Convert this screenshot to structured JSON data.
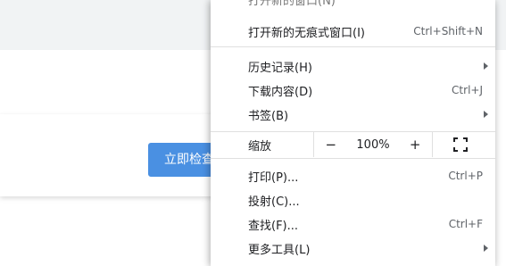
{
  "background": {
    "check_button_label": "立即检查"
  },
  "menu": {
    "partial_top_label": "打开新的窗口(N)",
    "items_group1": [
      {
        "label": "打开新的无痕式窗口(I)",
        "shortcut": "Ctrl+Shift+N"
      }
    ],
    "items_group2": [
      {
        "label": "历史记录(H)",
        "shortcut": "",
        "submenu": true
      },
      {
        "label": "下载内容(D)",
        "shortcut": "Ctrl+J",
        "submenu": false
      },
      {
        "label": "书签(B)",
        "shortcut": "",
        "submenu": true
      }
    ],
    "zoom": {
      "label": "缩放",
      "minus": "−",
      "value": "100%",
      "plus": "+"
    },
    "items_group3": [
      {
        "label": "打印(P)...",
        "shortcut": "Ctrl+P",
        "submenu": false
      },
      {
        "label": "投射(C)...",
        "shortcut": "",
        "submenu": false
      },
      {
        "label": "查找(F)...",
        "shortcut": "Ctrl+F",
        "submenu": false
      },
      {
        "label": "更多工具(L)",
        "shortcut": "",
        "submenu": true
      }
    ]
  },
  "colors": {
    "accent": "#4a90e2",
    "menu_bg": "#ffffff",
    "separator": "#e0e0e0"
  }
}
